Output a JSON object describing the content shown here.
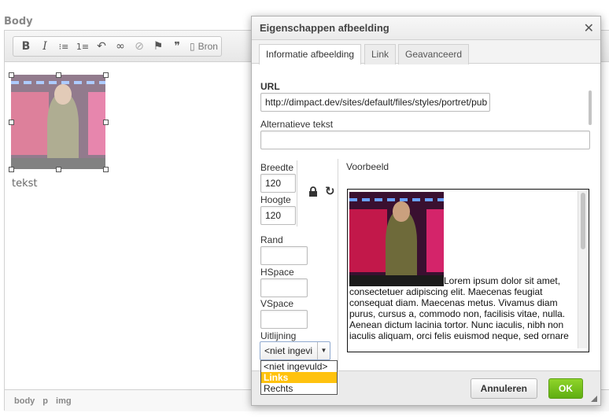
{
  "editor": {
    "field_label": "Body",
    "toolbar": {
      "bold": "B",
      "italic": "I",
      "bullet_list": "⁝≡",
      "numbered_list": "1≡",
      "undo": "↶",
      "link": "∞",
      "unlink": "⊘",
      "flag": "⚑",
      "quote": "❞",
      "source_label": "Bron"
    },
    "content_text": "tekst",
    "path": [
      "body",
      "p",
      "img"
    ]
  },
  "dialog": {
    "title": "Eigenschappen afbeelding",
    "tabs": [
      "Informatie afbeelding",
      "Link",
      "Geavanceerd"
    ],
    "active_tab": 0,
    "url_label": "URL",
    "url_value": "http://dimpact.dev/sites/default/files/styles/portret/pub",
    "alt_label": "Alternatieve tekst",
    "alt_value": "",
    "width_label": "Breedte",
    "width_value": "120",
    "height_label": "Hoogte",
    "height_value": "120",
    "border_label": "Rand",
    "border_value": "",
    "hspace_label": "HSpace",
    "hspace_value": "",
    "vspace_label": "VSpace",
    "vspace_value": "",
    "align_label": "Uitlijning",
    "align_value": "<niet ingevi",
    "align_options": [
      "<niet ingevuld>",
      "Links",
      "Rechts"
    ],
    "align_highlighted": "Links",
    "preview_label": "Voorbeeld",
    "preview_text": "Lorem ipsum dolor sit amet, consectetuer adipiscing elit. Maecenas feugiat consequat diam. Maecenas metus. Vivamus diam purus, cursus a, commodo non, facilisis vitae, nulla. Aenean dictum lacinia tortor. Nunc iaculis, nibh non iaculis aliquam, orci felis euismod neque, sed ornare",
    "cancel_label": "Annuleren",
    "ok_label": "OK",
    "close_glyph": "✕",
    "reset_glyph": "↻"
  },
  "colors": {
    "ok_button": "#6cbd1a",
    "dropdown_highlight": "#ffc20e"
  }
}
